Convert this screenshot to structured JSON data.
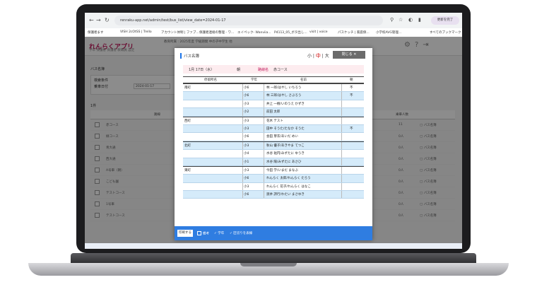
{
  "browser": {
    "url": "renraku-app.net/admin/test/bus_list/view_date=2024-01-17",
    "profile_label": "更新を完了",
    "bookmarks": [
      "保護者ます",
      "VISH 2cOtSS | Trello",
      "アカウント体制 | ファブ...",
      "保護者連絡の整理 - ワ...",
      "エイペック- Wanviia...",
      "P4113_05_ボタ出し...",
      "visit | voice",
      "パスケッチ | 家庭保...",
      "小学校AVG管理...",
      "すべてのブックマーク"
    ]
  },
  "app": {
    "logo": "れんらくアプリ",
    "header_info": "教育所属 : 2025年度   学級期間   中の子中学生 他",
    "tabs": "学年 保護者   保護者   教職員   設定",
    "page_title": "バス名簿",
    "condition_label": "検索条件",
    "date_label": "乗車日付",
    "date_value": "2024-01-17",
    "section_label": "1件",
    "bg_table": {
      "headers": [
        "",
        "路線",
        "",
        "乗車人数",
        ""
      ],
      "rows": [
        {
          "name": "赤コース",
          "count": "11",
          "action": "バス名簿"
        },
        {
          "name": "緑コース",
          "count": "0人",
          "action": "バス名簿"
        },
        {
          "name": "青大通",
          "count": "0人",
          "action": "バス名簿"
        },
        {
          "name": "西大通",
          "count": "0人",
          "action": "バス名簿"
        },
        {
          "name": "A号車（朝）",
          "count": "0人",
          "action": "バス名簿"
        },
        {
          "name": "こども園",
          "count": "0人",
          "action": "バス名簿"
        },
        {
          "name": "テストコース",
          "count": "0人",
          "action": "バス名簿"
        },
        {
          "name": "1号車",
          "count": "0人",
          "action": "バス名簿"
        },
        {
          "name": "テストコース",
          "count": "0人",
          "action": "バス名簿"
        }
      ]
    }
  },
  "modal": {
    "title": "バス名簿",
    "font_small": "小",
    "font_mid": "中",
    "font_large": "大",
    "close_label": "閉じる",
    "date": "1月 17日（水）",
    "period": "朝",
    "route_label": "路線名",
    "route_value": "赤コース",
    "table": {
      "headers": [
        "停留所名",
        "学年",
        "名前",
        "朝"
      ],
      "rows": [
        {
          "stop": "南町",
          "grade": "小6",
          "name": "林 一郎/はやし いちろう",
          "mark": "不",
          "alt": false,
          "start": true
        },
        {
          "stop": "",
          "grade": "小6",
          "name": "林 三郎/はやし さぶろう",
          "mark": "不",
          "alt": true,
          "start": false
        },
        {
          "stop": "",
          "grade": "小3",
          "name": "井上 一樹/いのうえ かずき",
          "mark": "",
          "alt": false,
          "start": false
        },
        {
          "stop": "",
          "grade": "小2",
          "name": "前田 太郎",
          "mark": "",
          "alt": true,
          "start": false
        },
        {
          "stop": "西町",
          "grade": "小3",
          "name": "花木 テスト",
          "mark": "",
          "alt": false,
          "start": true
        },
        {
          "stop": "",
          "grade": "小3",
          "name": "田中 そうた/たなか そうた",
          "mark": "不",
          "alt": true,
          "start": false
        },
        {
          "stop": "",
          "grade": "小6",
          "name": "会田 芽衣/あいだ めい",
          "mark": "",
          "alt": false,
          "start": false
        },
        {
          "stop": "北町",
          "grade": "小3",
          "name": "秋山 優子/あきやま てつこ",
          "mark": "",
          "alt": true,
          "start": true
        },
        {
          "stop": "",
          "grade": "小4",
          "name": "水谷 祐円/みずたに ゆうき",
          "mark": "",
          "alt": false,
          "start": false
        },
        {
          "stop": "",
          "grade": "小1",
          "name": "水谷 陽/みずたに あさひ",
          "mark": "",
          "alt": true,
          "start": false
        },
        {
          "stop": "東町",
          "grade": "小3",
          "name": "今田 学/いまだ まなぶ",
          "mark": "",
          "alt": false,
          "start": true
        },
        {
          "stop": "",
          "grade": "小6",
          "name": "れんらく 太郎/れんらく たろう",
          "mark": "",
          "alt": true,
          "start": false
        },
        {
          "stop": "",
          "grade": "小3",
          "name": "れんらく 花子/れんらく はなこ",
          "mark": "",
          "alt": false,
          "start": false
        },
        {
          "stop": "",
          "grade": "小6",
          "name": "渡井 詩行/わたい まさゆき",
          "mark": "",
          "alt": true,
          "start": false
        }
      ]
    },
    "footer": {
      "print_label": "印刷する",
      "opt_remarks": "備考",
      "opt_grade": "学年",
      "opt_cut": "区切りを表線"
    }
  }
}
